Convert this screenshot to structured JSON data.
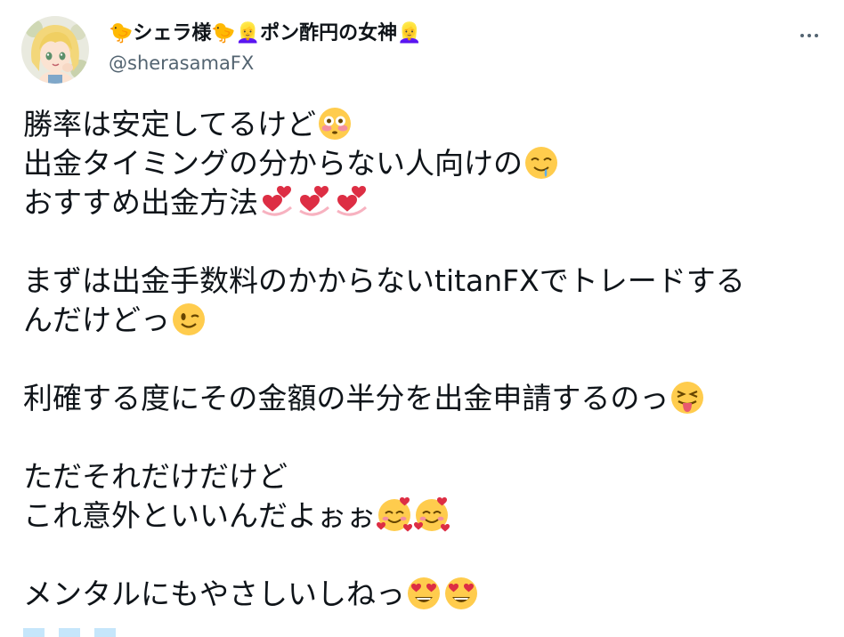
{
  "tweet": {
    "display_name": "🐤シェラ様🐤👱‍♀️ポン酢円の女神👱‍♀️",
    "handle": "@sherasamaFX",
    "more_icon": "more-horizontal-icon",
    "avatar_icon": "avatar-anime-girl"
  },
  "body": {
    "p1": {
      "l1": "勝率は安定してるけど",
      "l2": "出金タイミングの分からない人向けの",
      "l3": "おすすめ出金方法"
    },
    "p2": {
      "l1": "まずは出金手数料のかからないtitanFXでトレードする",
      "l2": "んだけどっ"
    },
    "p3": {
      "l1": "利確する度にその金額の半分を出金申請するのっ"
    },
    "p4": {
      "l1": "ただそれだけだけど",
      "l2": "これ意外といいんだよぉぉ"
    },
    "p5": {
      "l1": "メンタルにもやさしいしねっ"
    }
  },
  "emoji_names": [
    "flushed-face",
    "drooling-face",
    "two-hearts",
    "winking-face",
    "squinting-tongue-face",
    "smiling-face-with-hearts",
    "heart-eyes-face"
  ],
  "colors": {
    "text": "#0f1419",
    "secondary": "#536471",
    "emoji_yellow": "#f8c33a"
  }
}
